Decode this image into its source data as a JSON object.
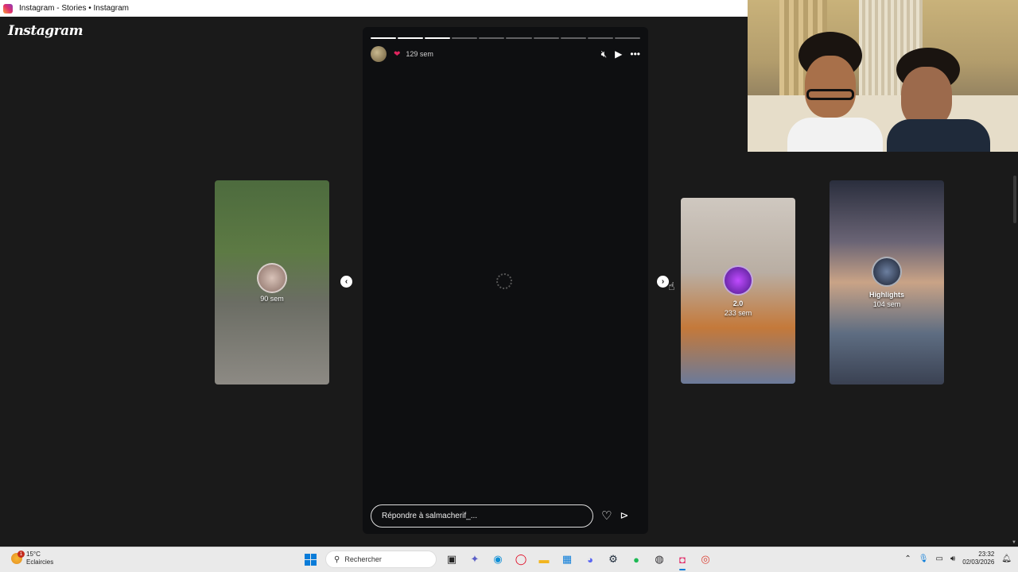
{
  "window": {
    "title": "Instagram - Stories • Instagram"
  },
  "brand": {
    "logo_text": "Instagram"
  },
  "story": {
    "progress_total": 10,
    "progress_done": 3,
    "time": "129 sem",
    "reply_placeholder": "Répondre à salmacherif_..."
  },
  "side_stories": {
    "left": {
      "time": "90 sem"
    },
    "mid": {
      "name": "2.0",
      "time": "233 sem"
    },
    "right": {
      "name": "Highlights",
      "time": "104 sem"
    }
  },
  "taskbar": {
    "weather_temp": "15°C",
    "weather_desc": "Eclaircies",
    "weather_badge": "1",
    "search_label": "Rechercher",
    "time": "23:32",
    "date": "02/03/2026"
  },
  "colors": {
    "background": "#1a1a1a",
    "story_bg": "#0e0f11",
    "accent_blue": "#0a7cd9"
  },
  "icons": [
    "mute-icon",
    "play-icon",
    "more-icon",
    "heart-icon",
    "send-icon",
    "chevron-left-icon",
    "chevron-right-icon"
  ]
}
